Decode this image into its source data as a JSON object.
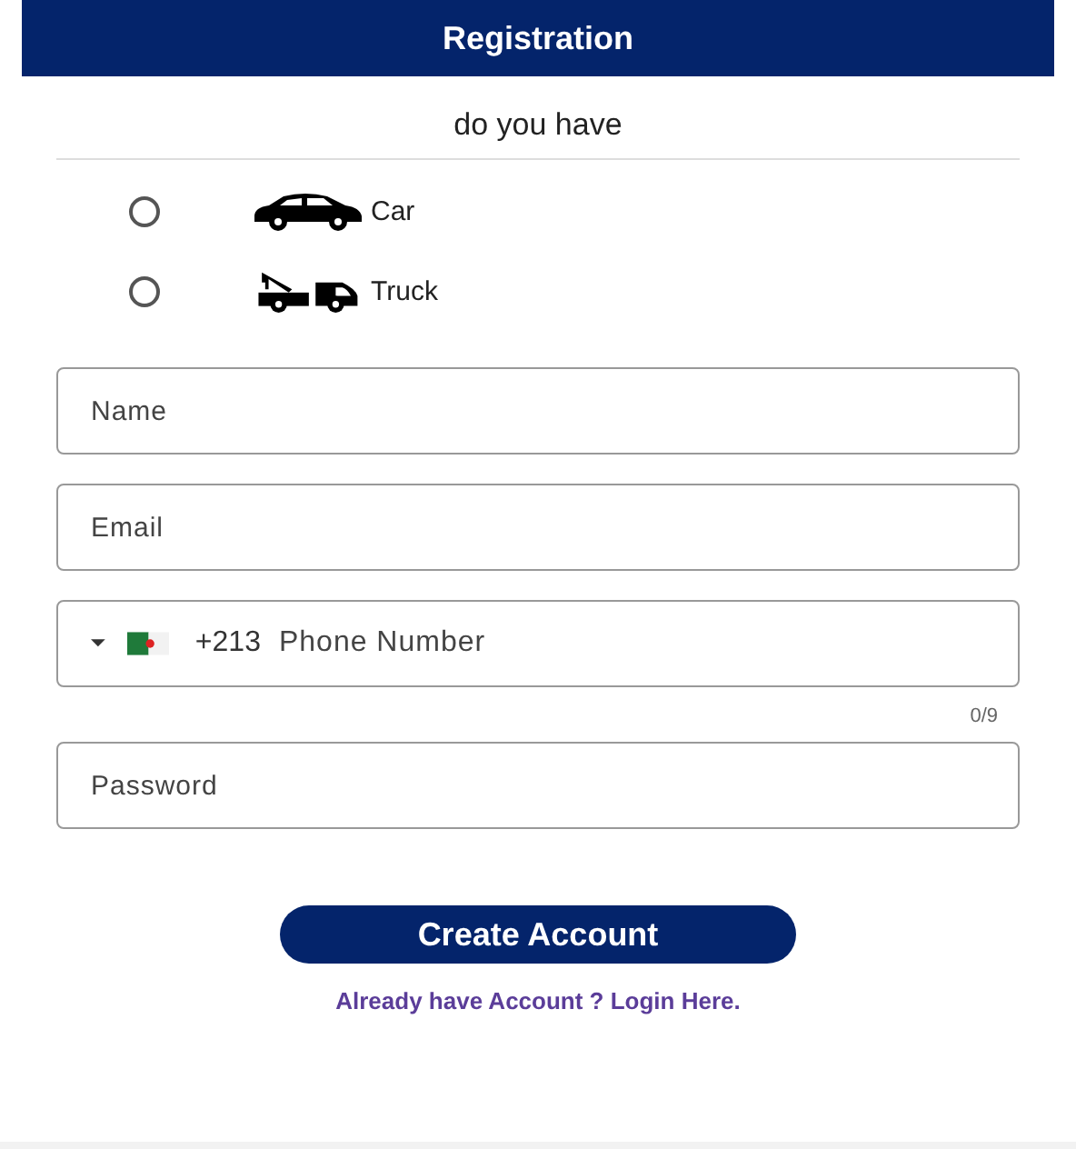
{
  "header": {
    "title": "Registration"
  },
  "question": "do you have",
  "options": [
    {
      "kind": "car",
      "label": "Car",
      "selected": false
    },
    {
      "kind": "truck",
      "label": "Truck",
      "selected": false
    }
  ],
  "fields": [
    {
      "kind": "text",
      "placeholder": "Name"
    },
    {
      "kind": "text",
      "placeholder": "Email"
    },
    {
      "kind": "phone",
      "code": "+213",
      "placeholder": "Phone Number",
      "counter": "0/9"
    },
    {
      "kind": "text",
      "placeholder": "Password"
    }
  ],
  "button": "Create Account",
  "login_link": "Already have Account ? Login Here."
}
